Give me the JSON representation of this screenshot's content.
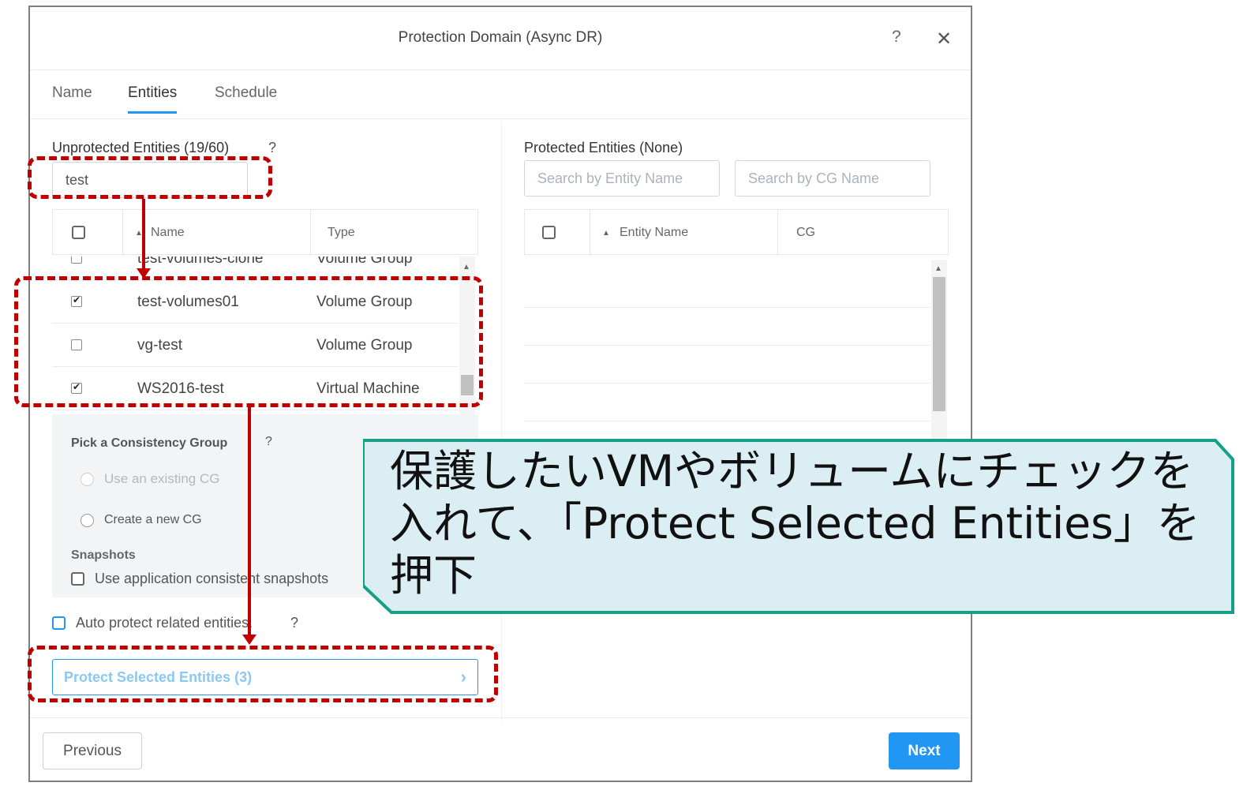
{
  "dialog": {
    "title": "Protection Domain (Async DR)",
    "help_icon": "?",
    "close_icon": "✕"
  },
  "tabs": [
    {
      "label": "Name"
    },
    {
      "label": "Entities",
      "active": true
    },
    {
      "label": "Schedule"
    }
  ],
  "unprotected": {
    "title": "Unprotected Entities (19/60)",
    "help": "?",
    "search_value": "test",
    "columns": {
      "name": "Name",
      "type": "Type"
    },
    "partial_row": {
      "name": "test-volumes-clone",
      "type": "Volume Group"
    },
    "rows": [
      {
        "name": "test-volumes01",
        "type": "Volume Group",
        "checked": true
      },
      {
        "name": "vg-test",
        "type": "Volume Group",
        "checked": false
      },
      {
        "name": "WS2016-test",
        "type": "Virtual Machine",
        "checked": true
      }
    ]
  },
  "protected": {
    "title": "Protected Entities (None)",
    "search_entity_placeholder": "Search by Entity Name",
    "search_cg_placeholder": "Search by CG Name",
    "columns": {
      "entity_name": "Entity Name",
      "cg": "CG"
    }
  },
  "consistency": {
    "title": "Pick a Consistency Group",
    "help": "?",
    "option_existing": "Use an existing CG",
    "option_new": "Create a new CG",
    "snapshots_title": "Snapshots",
    "app_consistent_label": "Use application consistent snapshots"
  },
  "auto_protect": {
    "label": "Auto protect related entities.",
    "help": "?"
  },
  "protect_button": {
    "label": "Protect Selected Entities (3)",
    "chevron": "›"
  },
  "footer": {
    "previous": "Previous",
    "next": "Next"
  },
  "callout": {
    "text": "保護したいVMやボリュームにチェックを入れて、「Protect Selected Entities」を押下"
  },
  "colors": {
    "accent": "#2196f3",
    "highlight": "#c00000",
    "callout_fill": "#daeef3",
    "callout_border": "#16a085"
  }
}
